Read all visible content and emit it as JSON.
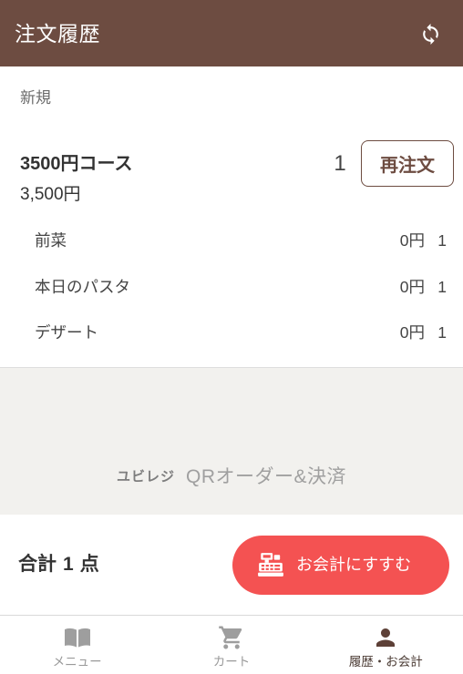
{
  "header": {
    "title": "注文履歴",
    "refresh_icon": "sync-icon"
  },
  "orders": {
    "section_label": "新規",
    "items": [
      {
        "name": "3500円コース",
        "price": "3,500円",
        "quantity": "1",
        "reorder_label": "再注文",
        "options": [
          {
            "name": "前菜",
            "price": "0円",
            "quantity": "1"
          },
          {
            "name": "本日のパスタ",
            "price": "0円",
            "quantity": "1"
          },
          {
            "name": "デザート",
            "price": "0円",
            "quantity": "1"
          }
        ]
      }
    ]
  },
  "branding": {
    "brand": "ユビレジ",
    "product": "QRオーダー&決済"
  },
  "total": {
    "label": "合計",
    "count": "1",
    "unit": "点",
    "checkout_label": "お会計にすすむ",
    "checkout_icon": "cash-register-icon"
  },
  "nav": {
    "items": [
      {
        "label": "メニュー",
        "icon": "book-icon",
        "active": false
      },
      {
        "label": "カート",
        "icon": "cart-icon",
        "active": false
      },
      {
        "label": "履歴・お会計",
        "icon": "person-icon",
        "active": true
      }
    ]
  },
  "colors": {
    "brand": "#6d4c41",
    "checkout": "#f45252",
    "nav_active": "#5d4037",
    "nav_inactive": "#9e9e9e",
    "muted_bg": "#f2f1ee"
  }
}
